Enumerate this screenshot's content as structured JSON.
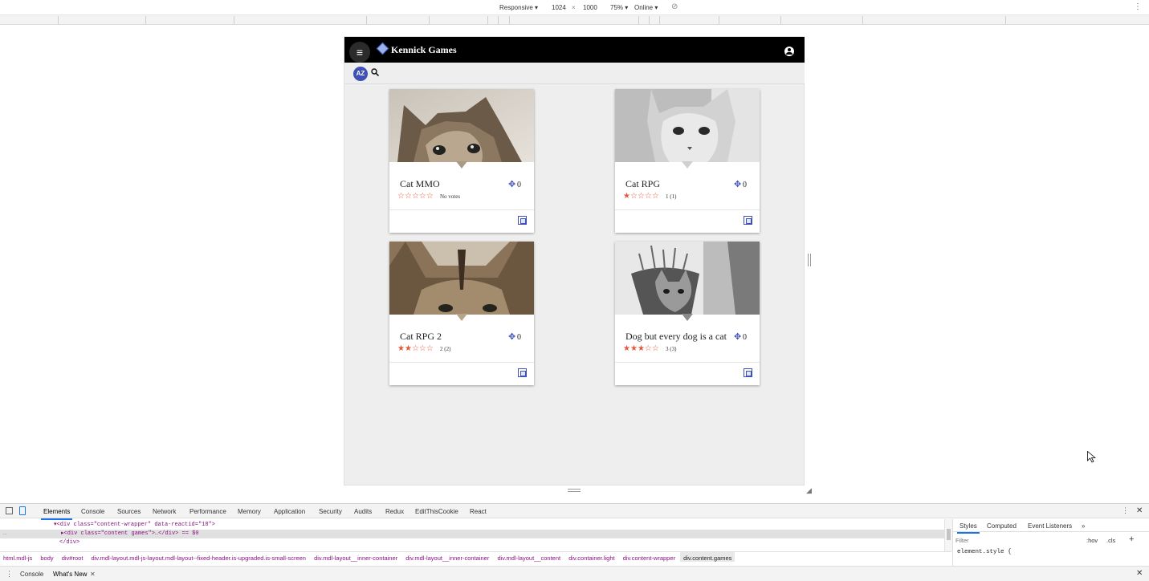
{
  "device_toolbar": {
    "mode": "Responsive",
    "width": "1024",
    "times": "×",
    "height": "1000",
    "zoom": "75%",
    "network": "Online"
  },
  "app": {
    "title": "Kennick Games",
    "az_label": "AZ",
    "games": [
      {
        "title": "Cat MMO",
        "votes": "0",
        "stars_filled": 0,
        "rating_text": "No votes"
      },
      {
        "title": "Cat RPG",
        "votes": "0",
        "stars_filled": 1,
        "rating_text": "1 (1)"
      },
      {
        "title": "Cat RPG 2",
        "votes": "0",
        "stars_filled": 2,
        "rating_text": "2 (2)"
      },
      {
        "title": "Dog but every dog is a cat",
        "votes": "0",
        "stars_filled": 3,
        "rating_text": "3 (3)"
      }
    ]
  },
  "devtools": {
    "tabs": [
      "Elements",
      "Console",
      "Sources",
      "Network",
      "Performance",
      "Memory",
      "Application",
      "Security",
      "Audits",
      "Redux",
      "EditThisCookie",
      "React"
    ],
    "dom": {
      "line1": "<div class=\"content-wrapper\" data-reactid=\"18\">",
      "line2": "<div class=\"content games\">…</div> == $0",
      "line3": "</div>"
    },
    "breadcrumbs": [
      "html.mdl-js",
      "body",
      "div#root",
      "div.mdl-layout.mdl-js-layout.mdl-layout--fixed-header.is-upgraded.is-small-screen",
      "div.mdl-layout__inner-container",
      "div.mdl-layout__inner-container",
      "div.mdl-layout__content",
      "div.container.light",
      "div.content-wrapper",
      "div.content.games"
    ],
    "styles_tabs": [
      "Styles",
      "Computed",
      "Event Listeners"
    ],
    "filter_placeholder": "Filter",
    "hov": ":hov",
    "cls": ".cls",
    "element_style": "element.style {",
    "drawer_tabs": [
      "Console",
      "What's New"
    ]
  },
  "colors": {
    "accent": "#3f51b5",
    "star": "#e8573a",
    "header": "#000000"
  }
}
